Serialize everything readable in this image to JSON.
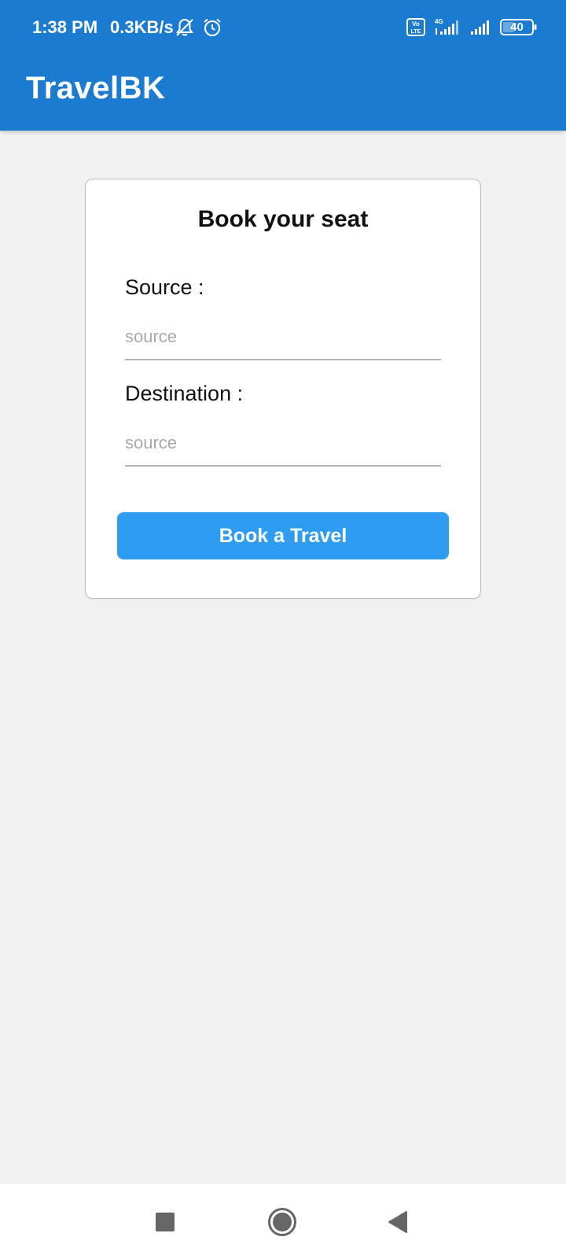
{
  "status_bar": {
    "time": "1:38 PM",
    "speed": "0.3KB/s",
    "icons": [
      "bell-off-icon",
      "alarm-icon",
      "volte-icon",
      "signal-4g-icon",
      "signal-icon",
      "battery-icon"
    ],
    "volte_text": "Vo LTE",
    "network_type": "4G",
    "battery_level": "40"
  },
  "app_bar": {
    "title": "TravelBK",
    "color": "#1a7bd1"
  },
  "card": {
    "title": "Book your seat",
    "source_label": "Source :",
    "source_placeholder": "source",
    "source_value": "",
    "destination_label": "Destination :",
    "destination_placeholder": "source",
    "destination_value": "",
    "button_label": "Book a Travel",
    "button_color": "#2d9cf1"
  },
  "nav_bar": {
    "icons": [
      "recents-square-icon",
      "home-circle-icon",
      "back-triangle-icon"
    ]
  }
}
